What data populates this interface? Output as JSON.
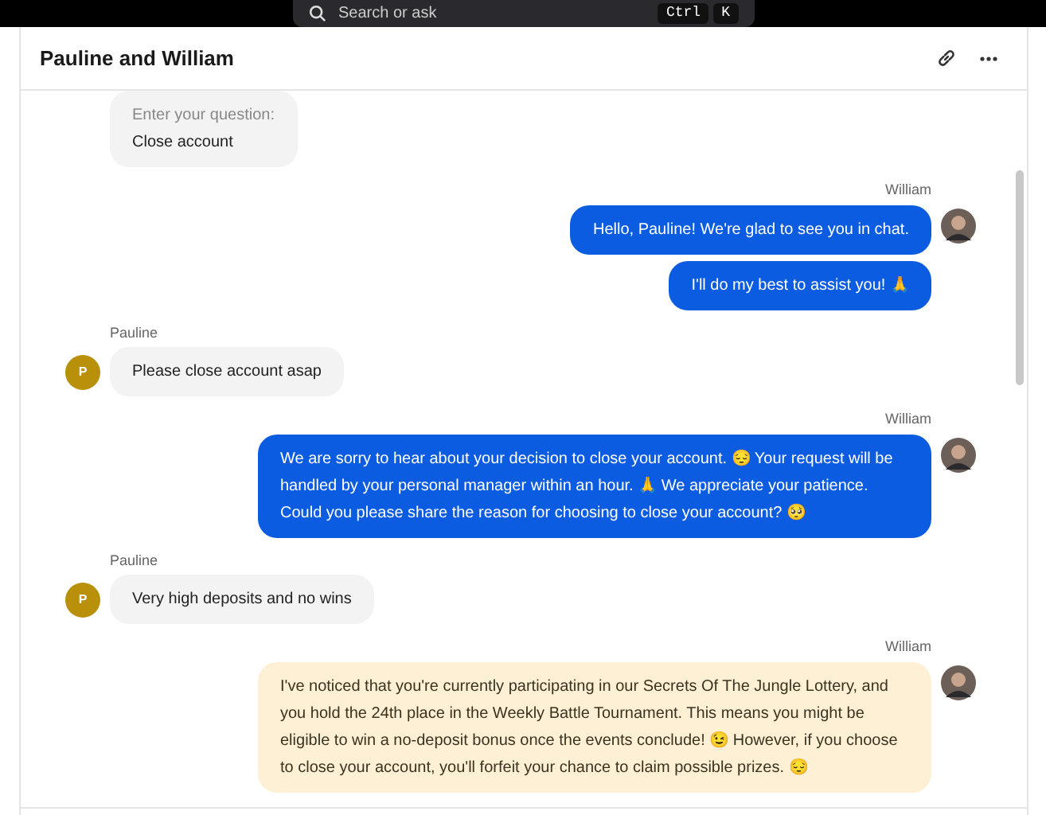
{
  "top_bar": {
    "search": {
      "placeholder": "Search or ask"
    },
    "shortcut": [
      "Ctrl",
      "K"
    ]
  },
  "chat": {
    "title": "Pauline and William",
    "groups": [
      {
        "kind": "customer",
        "messages": [
          {
            "kind": "plain",
            "lines": [
              "Enter your question:",
              "Close account"
            ]
          }
        ]
      },
      {
        "kind": "agent",
        "author": "William",
        "messages": [
          {
            "kind": "agent",
            "lines": [
              "Hello, Pauline! We're glad to see you in chat."
            ]
          },
          {
            "kind": "agent",
            "lines": [
              "I'll do my best to assist you! 🙏"
            ]
          }
        ]
      },
      {
        "kind": "customer",
        "author": "Pauline",
        "avatar": "P",
        "messages": [
          {
            "kind": "plain",
            "lines": [
              "Please close account asap"
            ]
          }
        ]
      },
      {
        "kind": "agent",
        "author": "William",
        "messages": [
          {
            "kind": "agent",
            "lines": [
              "We are sorry to hear about your decision to close your account. 😔 Your request will be handled by your personal manager within an hour. 🙏 We appreciate your patience. Could you please share the reason for choosing to close your account? 🥺"
            ]
          }
        ]
      },
      {
        "kind": "customer",
        "author": "Pauline",
        "avatar": "P",
        "messages": [
          {
            "kind": "plain",
            "lines": [
              "Very high deposits and no wins"
            ]
          }
        ]
      },
      {
        "kind": "agent",
        "author": "William",
        "messages": [
          {
            "kind": "suggestion",
            "lines": [
              "I've noticed that you're currently participating in our Secrets Of The Jungle Lottery, and you hold the 24th place in the Weekly Battle Tournament. This means you might be eligible to win a no-deposit bonus once the events conclude! 😉 However, if you choose to close your account, you'll forfeit your chance to claim possible prizes. 😔"
            ]
          }
        ]
      }
    ]
  }
}
